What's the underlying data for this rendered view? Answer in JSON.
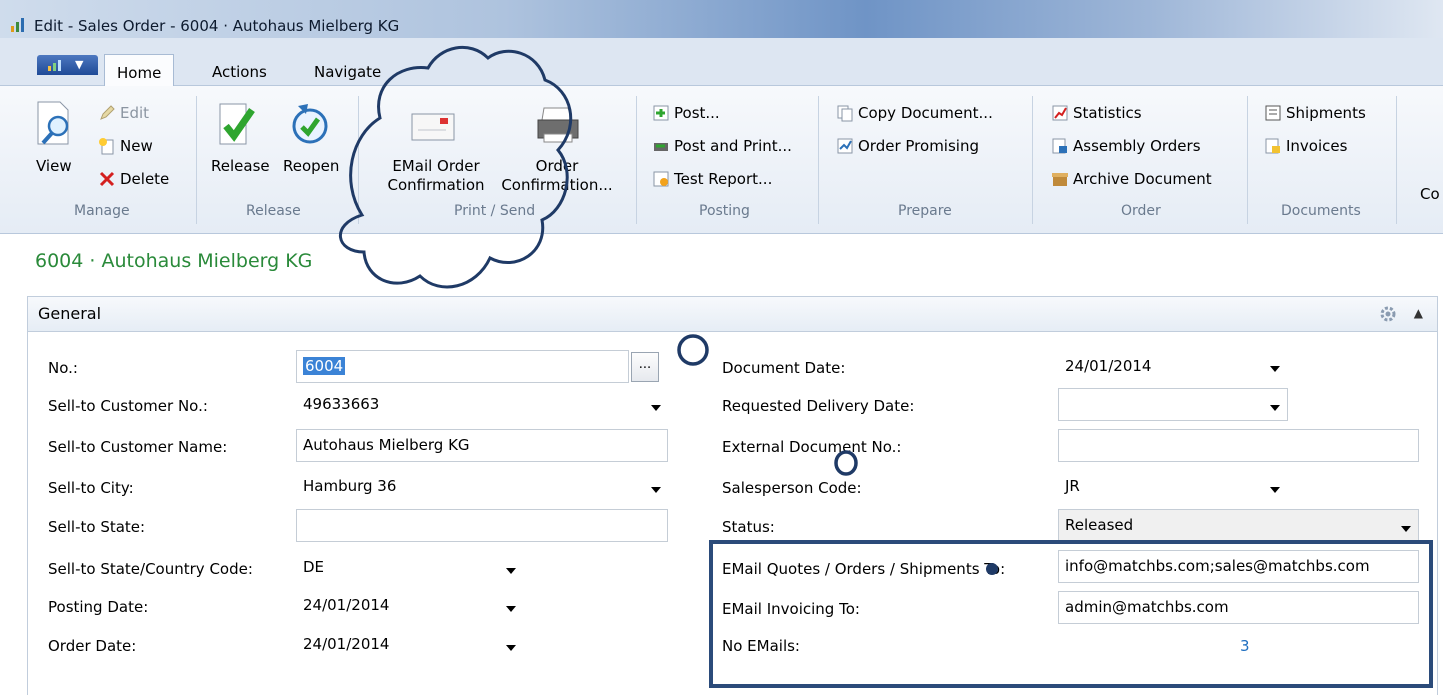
{
  "window": {
    "title": "Edit - Sales Order - 6004 · Autohaus Mielberg KG"
  },
  "ribbon_tabs": {
    "home": "Home",
    "actions": "Actions",
    "navigate": "Navigate"
  },
  "ribbon": {
    "manage": {
      "label": "Manage",
      "view": "View",
      "edit": "Edit",
      "new": "New",
      "delete": "Delete"
    },
    "release": {
      "label": "Release",
      "release": "Release",
      "reopen": "Reopen"
    },
    "print_send": {
      "label": "Print / Send",
      "email_line1": "EMail Order",
      "email_line2": "Confirmation",
      "order_line1": "Order",
      "order_line2": "Confirmation..."
    },
    "posting": {
      "label": "Posting",
      "post": "Post...",
      "post_print": "Post and Print...",
      "test_report": "Test Report..."
    },
    "prepare": {
      "label": "Prepare",
      "copy_document": "Copy Document...",
      "order_promising": "Order Promising"
    },
    "order": {
      "label": "Order",
      "statistics": "Statistics",
      "assembly_orders": "Assembly Orders",
      "archive_document": "Archive Document"
    },
    "documents": {
      "label": "Documents",
      "shipments": "Shipments",
      "invoices": "Invoices"
    },
    "overflow": "Co"
  },
  "page_title": "6004 · Autohaus Mielberg KG",
  "general": {
    "title": "General",
    "left": {
      "no_label": "No.:",
      "no_value": "6004",
      "customer_no_label": "Sell-to Customer No.:",
      "customer_no_value": "49633663",
      "customer_name_label": "Sell-to Customer Name:",
      "customer_name_value": "Autohaus Mielberg KG",
      "city_label": "Sell-to City:",
      "city_value": "Hamburg 36",
      "state_label": "Sell-to State:",
      "state_value": "",
      "country_label": "Sell-to State/Country Code:",
      "country_value": "DE",
      "posting_date_label": "Posting Date:",
      "posting_date_value": "24/01/2014",
      "order_date_label": "Order Date:",
      "order_date_value": "24/01/2014"
    },
    "right": {
      "doc_date_label": "Document Date:",
      "doc_date_value": "24/01/2014",
      "req_delivery_label": "Requested Delivery Date:",
      "req_delivery_value": "",
      "ext_doc_label": "External Document No.:",
      "ext_doc_value": "",
      "salesperson_label": "Salesperson Code:",
      "salesperson_value": "JR",
      "status_label": "Status:",
      "status_value": "Released",
      "email_quotes_label": "EMail Quotes / Orders / Shipments To:",
      "email_quotes_value": "info@matchbs.com;sales@matchbs.com",
      "email_invoicing_label": "EMail Invoicing To:",
      "email_invoicing_value": "admin@matchbs.com",
      "no_emails_label": "No EMails:",
      "no_emails_value": "3"
    }
  },
  "colors": {
    "title_green": "#2a8a3a",
    "highlight": "#2b4b7a",
    "link": "#1f6fc0"
  },
  "icons": [
    "app-logo-icon",
    "view-icon",
    "edit-icon",
    "new-icon",
    "delete-icon",
    "release-icon",
    "reopen-icon",
    "email-icon",
    "printer-icon",
    "post-icon",
    "post-print-icon",
    "test-report-icon",
    "copy-document-icon",
    "order-promising-icon",
    "statistics-icon",
    "assembly-orders-icon",
    "archive-document-icon",
    "shipments-icon",
    "invoices-icon",
    "gear-icon",
    "collapse-icon"
  ]
}
